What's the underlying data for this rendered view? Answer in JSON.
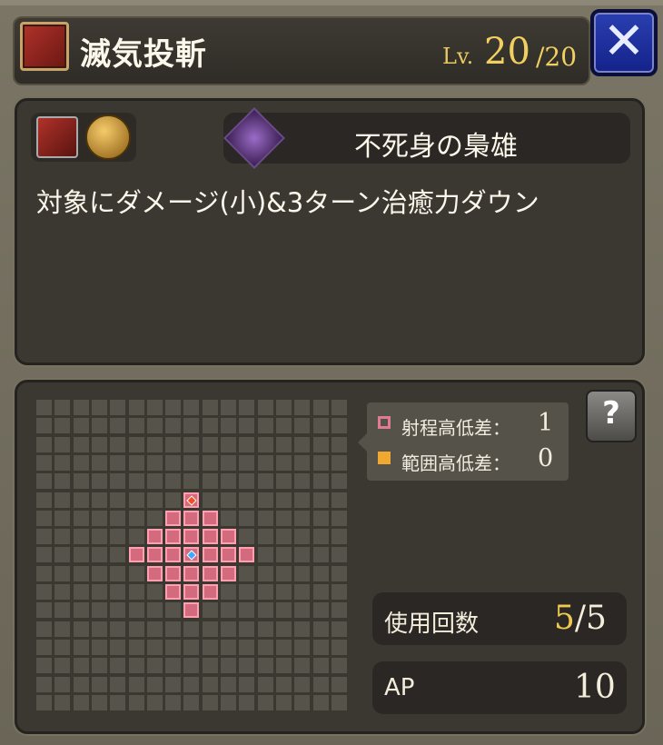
{
  "header": {
    "skill_icon": "skill-slash-icon",
    "skill_name": "滅気投斬",
    "level_prefix": "Lv.",
    "level_current": "20",
    "level_max": "/20",
    "close_icon": "close-x-icon"
  },
  "skill_info": {
    "attribute_icons": [
      "slash-attribute-icon",
      "gold-effect-icon"
    ],
    "trait_icon": "purple-skull-icon",
    "trait_name": "不死身の梟雄",
    "description": "対象にダメージ(小)&3ターン治癒力ダウン"
  },
  "range": {
    "legend": [
      {
        "label": "射程高低差：",
        "value": "1",
        "swatch_color": "#e07b91"
      },
      {
        "label": "範囲高低差：",
        "value": "0",
        "swatch_color": "#f0a830"
      }
    ],
    "help_icon": "question-book-icon"
  },
  "stats": {
    "uses_label": "使用回数",
    "uses_current": "5",
    "uses_max": "/5",
    "ap_label": "AP",
    "ap_value": "10"
  },
  "colors": {
    "accent_gold": "#f0d060",
    "range_pink": "#d46a7d",
    "close_blue": "#1f2f9e"
  }
}
